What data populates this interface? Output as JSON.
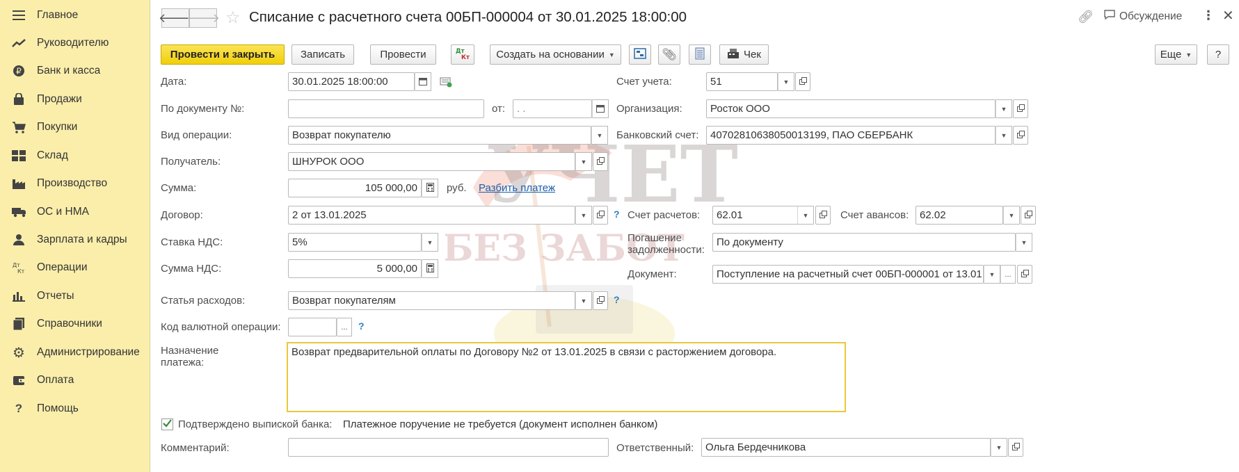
{
  "sidebar": {
    "items": [
      {
        "label": "Главное",
        "icon": "menu-icon"
      },
      {
        "label": "Руководителю",
        "icon": "trend-icon"
      },
      {
        "label": "Банк и касса",
        "icon": "ruble-coin-icon"
      },
      {
        "label": "Продажи",
        "icon": "shopping-bag-icon"
      },
      {
        "label": "Покупки",
        "icon": "cart-icon"
      },
      {
        "label": "Склад",
        "icon": "warehouse-icon"
      },
      {
        "label": "Производство",
        "icon": "factory-icon"
      },
      {
        "label": "ОС и НМА",
        "icon": "truck-icon"
      },
      {
        "label": "Зарплата и кадры",
        "icon": "people-icon"
      },
      {
        "label": "Операции",
        "icon": "dt-kt-icon"
      },
      {
        "label": "Отчеты",
        "icon": "bar-chart-icon"
      },
      {
        "label": "Справочники",
        "icon": "books-icon"
      },
      {
        "label": "Администрирование",
        "icon": "gear-icon"
      },
      {
        "label": "Оплата",
        "icon": "wallet-icon"
      },
      {
        "label": "Помощь",
        "icon": "question-icon"
      }
    ]
  },
  "header": {
    "title": "Списание с расчетного счета 00БП-000004 от 30.01.2025 18:00:00",
    "discussion": "Обсуждение"
  },
  "toolbar": {
    "post_close": "Провести и закрыть",
    "save": "Записать",
    "post": "Провести",
    "dtkt": "Дт Кт",
    "create_based": "Создать на основании",
    "check": "Чек",
    "more": "Еще",
    "help": "?"
  },
  "form": {
    "date_label": "Дата:",
    "date_value": "30.01.2025 18:00:00",
    "doc_no_label": "По документу №:",
    "doc_no_value": "",
    "from_label": "от:",
    "from_value": " .  .",
    "op_type_label": "Вид операции:",
    "op_type_value": "Возврат покупателю",
    "recipient_label": "Получатель:",
    "recipient_value": "ШНУРОК ООО",
    "sum_label": "Сумма:",
    "sum_value": "105 000,00",
    "currency": "руб.",
    "split_link": "Разбить платеж",
    "contract_label": "Договор:",
    "contract_value": "2 от 13.01.2025",
    "vat_rate_label": "Ставка НДС:",
    "vat_rate_value": "5%",
    "vat_sum_label": "Сумма НДС:",
    "vat_sum_value": "5 000,00",
    "expense_label": "Статья расходов:",
    "expense_value": "Возврат покупателям",
    "currency_op_label": "Код валютной операции:",
    "currency_op_value": "",
    "purpose_label_1": "Назначение",
    "purpose_label_2": "платежа:",
    "purpose_value": "Возврат предварительной оплаты по Договору №2 от 13.01.2025 в связи с расторжением договора.",
    "account_label": "Счет учета:",
    "account_value": "51",
    "org_label": "Организация:",
    "org_value": "Росток ООО",
    "bank_acc_label": "Банковский счет:",
    "bank_acc_value": "40702810638050013199, ПАО СБЕРБАНК",
    "settle_acc_label": "Счет расчетов:",
    "settle_acc_value": "62.01",
    "adv_acc_label": "Счет авансов:",
    "adv_acc_value": "62.02",
    "repay_label_1": "Погашение",
    "repay_label_2": "задолженности:",
    "repay_value": "По документу",
    "document_label": "Документ:",
    "document_value": "Поступление на расчетный счет 00БП-000001 от 13.01",
    "confirmed_label": "Подтверждено выпиской банка:",
    "confirmed_checked": true,
    "payment_note": "Платежное поручение не требуется (документ исполнен банком)",
    "comment_label": "Комментарий:",
    "comment_value": "",
    "responsible_label": "Ответственный:",
    "responsible_value": "Ольга Бердечникова",
    "help_mark": "?"
  },
  "watermark": {
    "line1": "УЧЕТ",
    "line2": "БЕЗ ЗАБОТ"
  },
  "colors": {
    "sidebar_bg": "#fbeeab",
    "primary_button": "#f0cf0b",
    "link": "#1b5eac",
    "help": "#2d7fc1"
  }
}
